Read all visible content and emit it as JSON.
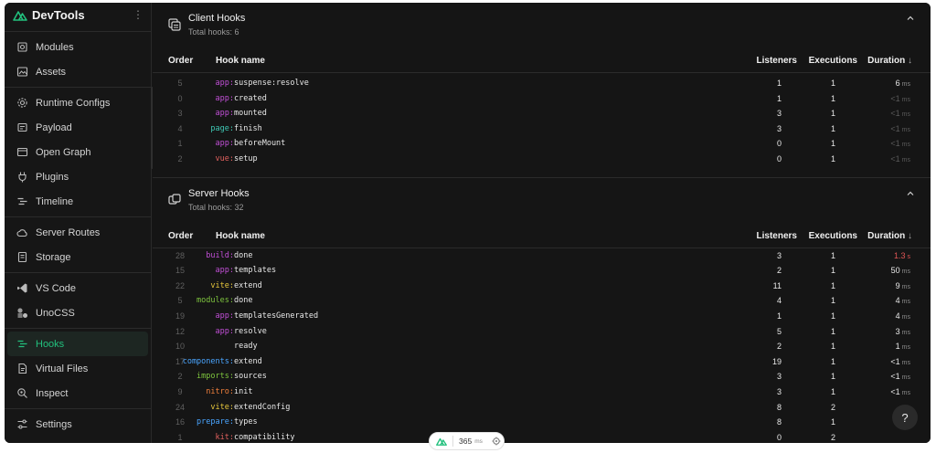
{
  "app": {
    "name": "DevTools",
    "menu_glyph": "⋮",
    "accent": "#22c07d"
  },
  "sidebar": {
    "groups": [
      [
        {
          "label": "Modules",
          "icon": "modules-icon"
        },
        {
          "label": "Assets",
          "icon": "assets-icon"
        }
      ],
      [
        {
          "label": "Runtime Configs",
          "icon": "gear-icon"
        },
        {
          "label": "Payload",
          "icon": "payload-icon"
        },
        {
          "label": "Open Graph",
          "icon": "open-graph-icon"
        },
        {
          "label": "Plugins",
          "icon": "plug-icon"
        },
        {
          "label": "Timeline",
          "icon": "timeline-icon"
        }
      ],
      [
        {
          "label": "Server Routes",
          "icon": "cloud-icon"
        },
        {
          "label": "Storage",
          "icon": "storage-icon"
        }
      ],
      [
        {
          "label": "VS Code",
          "icon": "vscode-icon"
        },
        {
          "label": "UnoCSS",
          "icon": "unocss-icon"
        }
      ],
      [
        {
          "label": "Hooks",
          "icon": "hooks-icon",
          "active": true
        },
        {
          "label": "Virtual Files",
          "icon": "file-icon"
        },
        {
          "label": "Inspect",
          "icon": "inspect-icon"
        }
      ],
      [
        {
          "label": "Settings",
          "icon": "settings-icon"
        }
      ]
    ]
  },
  "columns": {
    "order": "Order",
    "name": "Hook name",
    "listeners": "Listeners",
    "executions": "Executions",
    "duration": "Duration",
    "sort_glyph": "↓"
  },
  "prefix_colors": {
    "app": "#c14fd6",
    "page": "#3fc9b5",
    "vue": "#e0605e",
    "build": "#c14fd6",
    "vite": "#e6c63c",
    "modules": "#7ec43e",
    "components": "#4aa5ff",
    "imports": "#7ec43e",
    "nitro": "#f07f3c",
    "prepare": "#4aa5ff",
    "kit": "#e0605e"
  },
  "client_hooks": {
    "title": "Client Hooks",
    "subtitle": "Total hooks: 6",
    "rows": [
      {
        "order": "5",
        "prefix": "app:",
        "pkey": "app",
        "name": "suspense:resolve",
        "listeners": "1",
        "executions": "1",
        "duration": "6",
        "unit": "ms",
        "style": ""
      },
      {
        "order": "0",
        "prefix": "app:",
        "pkey": "app",
        "name": "created",
        "listeners": "1",
        "executions": "1",
        "duration": "<1",
        "unit": "ms",
        "style": "dim"
      },
      {
        "order": "3",
        "prefix": "app:",
        "pkey": "app",
        "name": "mounted",
        "listeners": "3",
        "executions": "1",
        "duration": "<1",
        "unit": "ms",
        "style": "dim"
      },
      {
        "order": "4",
        "prefix": "page:",
        "pkey": "page",
        "name": "finish",
        "listeners": "3",
        "executions": "1",
        "duration": "<1",
        "unit": "ms",
        "style": "dim"
      },
      {
        "order": "1",
        "prefix": "app:",
        "pkey": "app",
        "name": "beforeMount",
        "listeners": "0",
        "executions": "1",
        "duration": "<1",
        "unit": "ms",
        "style": "dim"
      },
      {
        "order": "2",
        "prefix": "vue:",
        "pkey": "vue",
        "name": "setup",
        "listeners": "0",
        "executions": "1",
        "duration": "<1",
        "unit": "ms",
        "style": "dim"
      }
    ]
  },
  "server_hooks": {
    "title": "Server Hooks",
    "subtitle": "Total hooks: 32",
    "rows": [
      {
        "order": "28",
        "prefix": "build:",
        "pkey": "build",
        "name": "done",
        "listeners": "3",
        "executions": "1",
        "duration": "1.3",
        "unit": "s",
        "style": "red"
      },
      {
        "order": "15",
        "prefix": "app:",
        "pkey": "app",
        "name": "templates",
        "listeners": "2",
        "executions": "1",
        "duration": "50",
        "unit": "ms",
        "style": ""
      },
      {
        "order": "22",
        "prefix": "vite:",
        "pkey": "vite",
        "name": "extend",
        "listeners": "11",
        "executions": "1",
        "duration": "9",
        "unit": "ms",
        "style": ""
      },
      {
        "order": "5",
        "prefix": "modules:",
        "pkey": "modules",
        "name": "done",
        "listeners": "4",
        "executions": "1",
        "duration": "4",
        "unit": "ms",
        "style": ""
      },
      {
        "order": "19",
        "prefix": "app:",
        "pkey": "app",
        "name": "templatesGenerated",
        "listeners": "1",
        "executions": "1",
        "duration": "4",
        "unit": "ms",
        "style": ""
      },
      {
        "order": "12",
        "prefix": "app:",
        "pkey": "app",
        "name": "resolve",
        "listeners": "5",
        "executions": "1",
        "duration": "3",
        "unit": "ms",
        "style": ""
      },
      {
        "order": "10",
        "prefix": "",
        "pkey": "",
        "name": "ready",
        "listeners": "2",
        "executions": "1",
        "duration": "1",
        "unit": "ms",
        "style": ""
      },
      {
        "order": "17",
        "prefix": "components:",
        "pkey": "components",
        "name": "extend",
        "listeners": "19",
        "executions": "1",
        "duration": "<1",
        "unit": "ms",
        "style": ""
      },
      {
        "order": "2",
        "prefix": "imports:",
        "pkey": "imports",
        "name": "sources",
        "listeners": "3",
        "executions": "1",
        "duration": "<1",
        "unit": "ms",
        "style": ""
      },
      {
        "order": "9",
        "prefix": "nitro:",
        "pkey": "nitro",
        "name": "init",
        "listeners": "3",
        "executions": "1",
        "duration": "<1",
        "unit": "ms",
        "style": ""
      },
      {
        "order": "24",
        "prefix": "vite:",
        "pkey": "vite",
        "name": "extendConfig",
        "listeners": "8",
        "executions": "2",
        "duration": "<",
        "unit": "",
        "style": ""
      },
      {
        "order": "16",
        "prefix": "prepare:",
        "pkey": "prepare",
        "name": "types",
        "listeners": "8",
        "executions": "1",
        "duration": "",
        "unit": "",
        "style": ""
      },
      {
        "order": "1",
        "prefix": "kit:",
        "pkey": "kit",
        "name": "compatibility",
        "listeners": "0",
        "executions": "2",
        "duration": "",
        "unit": "",
        "style": ""
      }
    ]
  },
  "render_stats": {
    "value": "365",
    "unit": "ms"
  },
  "help": {
    "label": "?"
  }
}
